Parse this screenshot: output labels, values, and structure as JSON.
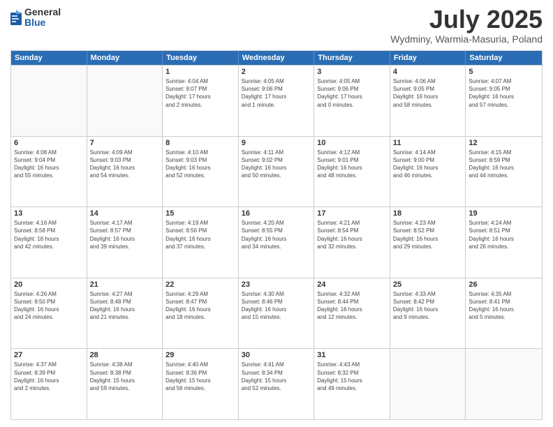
{
  "logo": {
    "general": "General",
    "blue": "Blue"
  },
  "header": {
    "title": "July 2025",
    "subtitle": "Wydminy, Warmia-Masuria, Poland"
  },
  "weekdays": [
    "Sunday",
    "Monday",
    "Tuesday",
    "Wednesday",
    "Thursday",
    "Friday",
    "Saturday"
  ],
  "weeks": [
    [
      {
        "day": "",
        "info": ""
      },
      {
        "day": "",
        "info": ""
      },
      {
        "day": "1",
        "info": "Sunrise: 4:04 AM\nSunset: 9:07 PM\nDaylight: 17 hours\nand 2 minutes."
      },
      {
        "day": "2",
        "info": "Sunrise: 4:05 AM\nSunset: 9:06 PM\nDaylight: 17 hours\nand 1 minute."
      },
      {
        "day": "3",
        "info": "Sunrise: 4:05 AM\nSunset: 9:06 PM\nDaylight: 17 hours\nand 0 minutes."
      },
      {
        "day": "4",
        "info": "Sunrise: 4:06 AM\nSunset: 9:05 PM\nDaylight: 16 hours\nand 58 minutes."
      },
      {
        "day": "5",
        "info": "Sunrise: 4:07 AM\nSunset: 9:05 PM\nDaylight: 16 hours\nand 57 minutes."
      }
    ],
    [
      {
        "day": "6",
        "info": "Sunrise: 4:08 AM\nSunset: 9:04 PM\nDaylight: 16 hours\nand 55 minutes."
      },
      {
        "day": "7",
        "info": "Sunrise: 4:09 AM\nSunset: 9:03 PM\nDaylight: 16 hours\nand 54 minutes."
      },
      {
        "day": "8",
        "info": "Sunrise: 4:10 AM\nSunset: 9:03 PM\nDaylight: 16 hours\nand 52 minutes."
      },
      {
        "day": "9",
        "info": "Sunrise: 4:11 AM\nSunset: 9:02 PM\nDaylight: 16 hours\nand 50 minutes."
      },
      {
        "day": "10",
        "info": "Sunrise: 4:12 AM\nSunset: 9:01 PM\nDaylight: 16 hours\nand 48 minutes."
      },
      {
        "day": "11",
        "info": "Sunrise: 4:14 AM\nSunset: 9:00 PM\nDaylight: 16 hours\nand 46 minutes."
      },
      {
        "day": "12",
        "info": "Sunrise: 4:15 AM\nSunset: 8:59 PM\nDaylight: 16 hours\nand 44 minutes."
      }
    ],
    [
      {
        "day": "13",
        "info": "Sunrise: 4:16 AM\nSunset: 8:58 PM\nDaylight: 16 hours\nand 42 minutes."
      },
      {
        "day": "14",
        "info": "Sunrise: 4:17 AM\nSunset: 8:57 PM\nDaylight: 16 hours\nand 39 minutes."
      },
      {
        "day": "15",
        "info": "Sunrise: 4:19 AM\nSunset: 8:56 PM\nDaylight: 16 hours\nand 37 minutes."
      },
      {
        "day": "16",
        "info": "Sunrise: 4:20 AM\nSunset: 8:55 PM\nDaylight: 16 hours\nand 34 minutes."
      },
      {
        "day": "17",
        "info": "Sunrise: 4:21 AM\nSunset: 8:54 PM\nDaylight: 16 hours\nand 32 minutes."
      },
      {
        "day": "18",
        "info": "Sunrise: 4:23 AM\nSunset: 8:52 PM\nDaylight: 16 hours\nand 29 minutes."
      },
      {
        "day": "19",
        "info": "Sunrise: 4:24 AM\nSunset: 8:51 PM\nDaylight: 16 hours\nand 26 minutes."
      }
    ],
    [
      {
        "day": "20",
        "info": "Sunrise: 4:26 AM\nSunset: 8:50 PM\nDaylight: 16 hours\nand 24 minutes."
      },
      {
        "day": "21",
        "info": "Sunrise: 4:27 AM\nSunset: 8:48 PM\nDaylight: 16 hours\nand 21 minutes."
      },
      {
        "day": "22",
        "info": "Sunrise: 4:29 AM\nSunset: 8:47 PM\nDaylight: 16 hours\nand 18 minutes."
      },
      {
        "day": "23",
        "info": "Sunrise: 4:30 AM\nSunset: 8:46 PM\nDaylight: 16 hours\nand 15 minutes."
      },
      {
        "day": "24",
        "info": "Sunrise: 4:32 AM\nSunset: 8:44 PM\nDaylight: 16 hours\nand 12 minutes."
      },
      {
        "day": "25",
        "info": "Sunrise: 4:33 AM\nSunset: 8:42 PM\nDaylight: 16 hours\nand 9 minutes."
      },
      {
        "day": "26",
        "info": "Sunrise: 4:35 AM\nSunset: 8:41 PM\nDaylight: 16 hours\nand 5 minutes."
      }
    ],
    [
      {
        "day": "27",
        "info": "Sunrise: 4:37 AM\nSunset: 8:39 PM\nDaylight: 16 hours\nand 2 minutes."
      },
      {
        "day": "28",
        "info": "Sunrise: 4:38 AM\nSunset: 8:38 PM\nDaylight: 15 hours\nand 59 minutes."
      },
      {
        "day": "29",
        "info": "Sunrise: 4:40 AM\nSunset: 8:36 PM\nDaylight: 15 hours\nand 56 minutes."
      },
      {
        "day": "30",
        "info": "Sunrise: 4:41 AM\nSunset: 8:34 PM\nDaylight: 15 hours\nand 52 minutes."
      },
      {
        "day": "31",
        "info": "Sunrise: 4:43 AM\nSunset: 8:32 PM\nDaylight: 15 hours\nand 49 minutes."
      },
      {
        "day": "",
        "info": ""
      },
      {
        "day": "",
        "info": ""
      }
    ]
  ]
}
